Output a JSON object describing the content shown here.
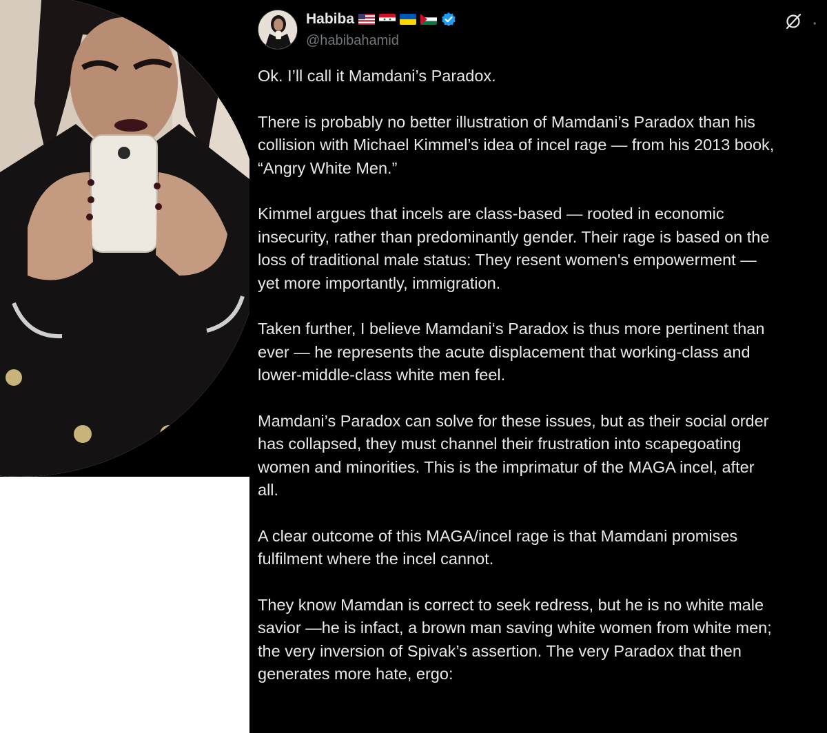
{
  "tweet": {
    "display_name": "Habiba",
    "handle": "@habibahamid",
    "flags": [
      "us-flag",
      "syria-flag",
      "ukraine-flag",
      "palestine-flag"
    ],
    "paragraphs": [
      [
        "Ok. I’ll call it Mamdani’s Paradox."
      ],
      [
        "There is probably no better illustration of Mamdani’s Paradox than his",
        "collision with Michael Kimmel’s idea of incel rage — from his 2013 book,",
        "“Angry White Men.”"
      ],
      [
        "Kimmel argues that incels are class-based — rooted in economic",
        "insecurity, rather than predominantly gender. Their rage is based on the",
        "loss of traditional male status: They resent women's empowerment —",
        "yet more importantly, immigration."
      ],
      [
        "Taken further, I believe Mamdani‘s Paradox is thus more pertinent than",
        "ever — he represents the acute displacement that working-class and",
        "lower-middle-class white men feel."
      ],
      [
        "Mamdani’s Paradox can solve for these issues, but as their social order",
        "has collapsed, they must channel their frustration into scapegoating",
        "women and minorities. This is the imprimatur of the MAGA incel, after",
        "all."
      ],
      [
        "A clear outcome of this MAGA/incel rage is that Mamdani promises",
        "fulfilment where the incel cannot."
      ],
      [
        "They know Mamdan is correct to seek redress, but he is no white male",
        "savior —he is infact, a brown man saving white women from white men;",
        "the very inversion of Spivak’s assertion. The very Paradox that then",
        "generates more hate, ergo:"
      ]
    ]
  },
  "colors": {
    "background": "#000000",
    "text": "#e7e9ea",
    "secondary": "#71767b",
    "verified": "#1d9bf0"
  }
}
